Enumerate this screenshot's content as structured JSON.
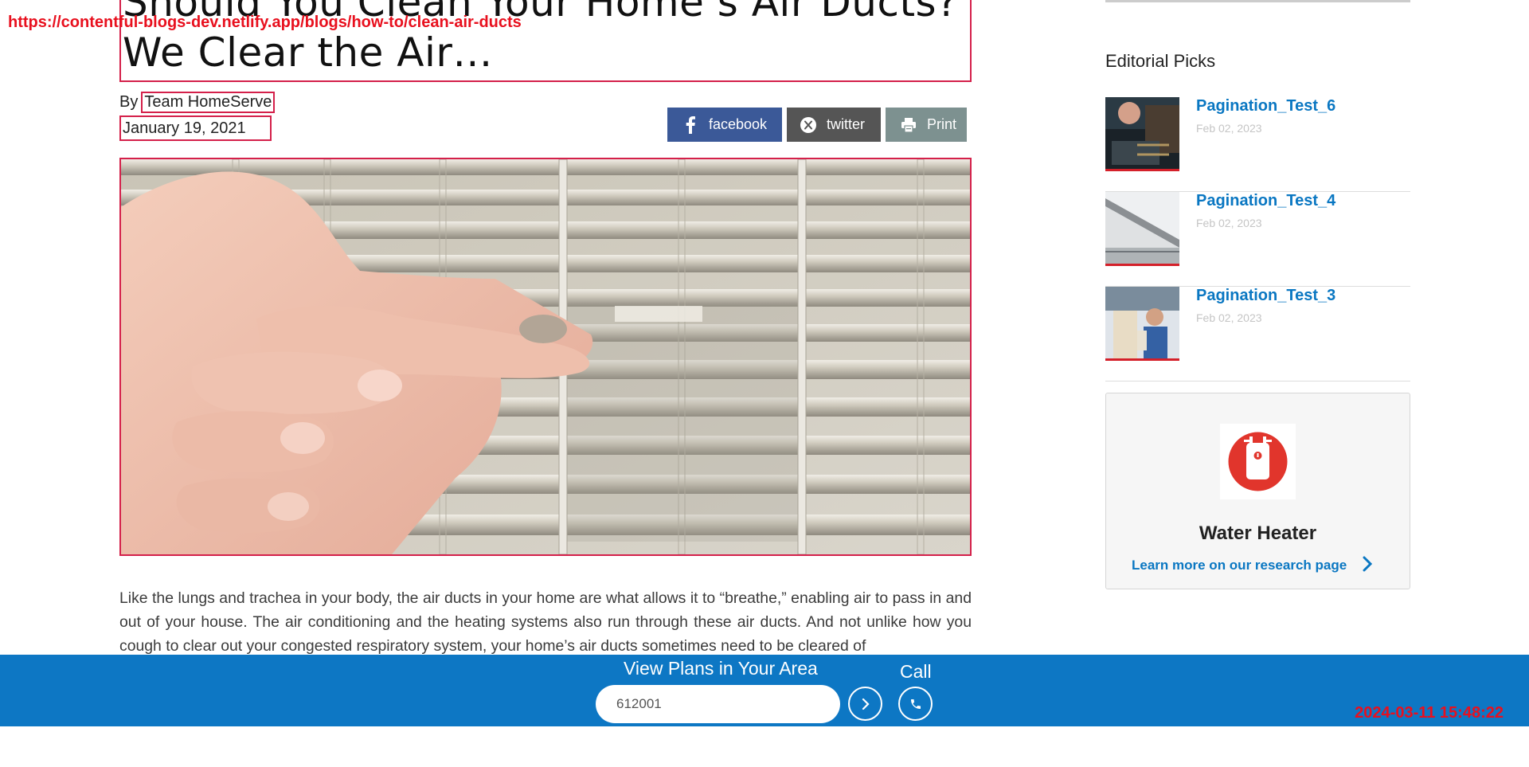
{
  "overlay": {
    "url": "https://contentful-blogs-dev.netlify.app/blogs/how-to/clean-air-ducts",
    "timestamp": "2024-03-11 15:48:22"
  },
  "article": {
    "title": "Should You Clean Your Home’s Air Ducts? We Clear the Air…",
    "by_label": "By",
    "author": "Team HomeServe",
    "date": "January 19, 2021",
    "body": "Like the lungs and trachea in your body, the air ducts in your home are what allows it to “breathe,” enabling air to pass in and out of your house. The air conditioning and the heating systems also run through these air ducts. And not unlike how you cough to clear out your congested respiratory system, your home’s air ducts sometimes need to be cleared of"
  },
  "share": {
    "facebook": "facebook",
    "twitter": "twitter",
    "print": "Print"
  },
  "sidebar": {
    "picks_title": "Editorial Picks",
    "picks": [
      {
        "title": "Pagination_Test_6",
        "date": "Feb 02, 2023"
      },
      {
        "title": "Pagination_Test_4",
        "date": "Feb 02, 2023"
      },
      {
        "title": "Pagination_Test_3",
        "date": "Feb 02, 2023"
      }
    ],
    "card": {
      "title": "Water Heater",
      "link": "Learn more on our research page"
    }
  },
  "bottom_bar": {
    "title": "View Plans in Your Area",
    "zip_value": "612001",
    "call_label": "Call"
  },
  "colors": {
    "brand_blue": "#0d77c4",
    "link_blue": "#0a77c2",
    "facebook": "#3b5998",
    "twitter": "#555555",
    "print": "#7d9190",
    "highlight_red": "#d4204a"
  }
}
